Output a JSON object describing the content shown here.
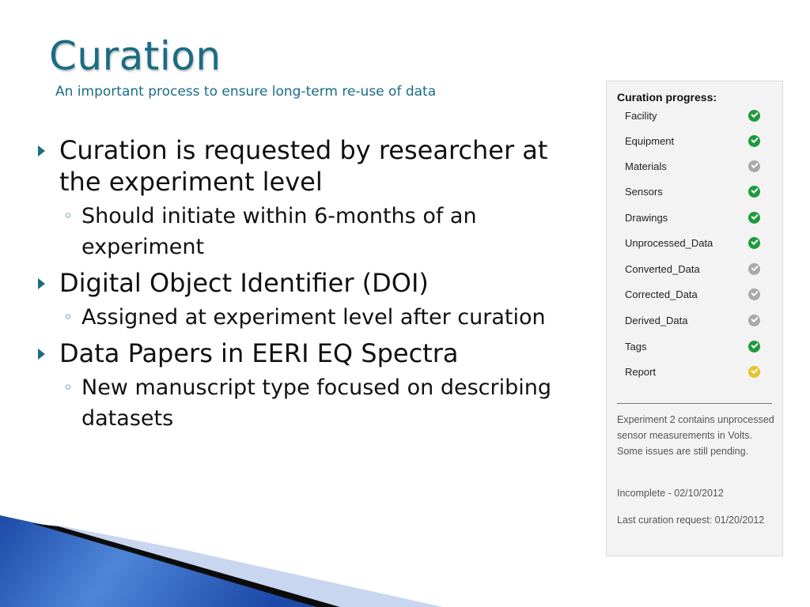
{
  "slide": {
    "title": "Curation",
    "subtitle": "An important process to ensure long-term re-use of data"
  },
  "bullets": [
    {
      "text": "Curation is requested by researcher at the experiment level",
      "sub": [
        "Should initiate within 6-months of an experiment"
      ]
    },
    {
      "text": "Digital Object Identifier (DOI)",
      "sub": [
        "Assigned at experiment level after curation"
      ]
    },
    {
      "text": "Data Papers in EERI EQ Spectra",
      "sub": [
        "New manuscript type focused on describing datasets"
      ]
    }
  ],
  "panel": {
    "heading": "Curation progress:",
    "items": [
      {
        "label": "Facility",
        "status": "complete"
      },
      {
        "label": "Equipment",
        "status": "complete"
      },
      {
        "label": "Materials",
        "status": "not-started"
      },
      {
        "label": "Sensors",
        "status": "complete"
      },
      {
        "label": "Drawings",
        "status": "complete"
      },
      {
        "label": "Unprocessed_Data",
        "status": "complete"
      },
      {
        "label": "Converted_Data",
        "status": "not-started"
      },
      {
        "label": "Corrected_Data",
        "status": "not-started"
      },
      {
        "label": "Derived_Data",
        "status": "not-started"
      },
      {
        "label": "Tags",
        "status": "complete"
      },
      {
        "label": "Report",
        "status": "pending"
      }
    ],
    "description": "Experiment 2 contains unprocessed sensor measurements in Volts. Some issues are still pending.",
    "status_line": "Incomplete - 02/10/2012",
    "last_request": "Last curation request: 01/20/2012"
  },
  "colors": {
    "accent": "#1a6c85",
    "complete": "#1e9a3c",
    "not-started": "#a9a9a9",
    "pending": "#e8c42a"
  }
}
